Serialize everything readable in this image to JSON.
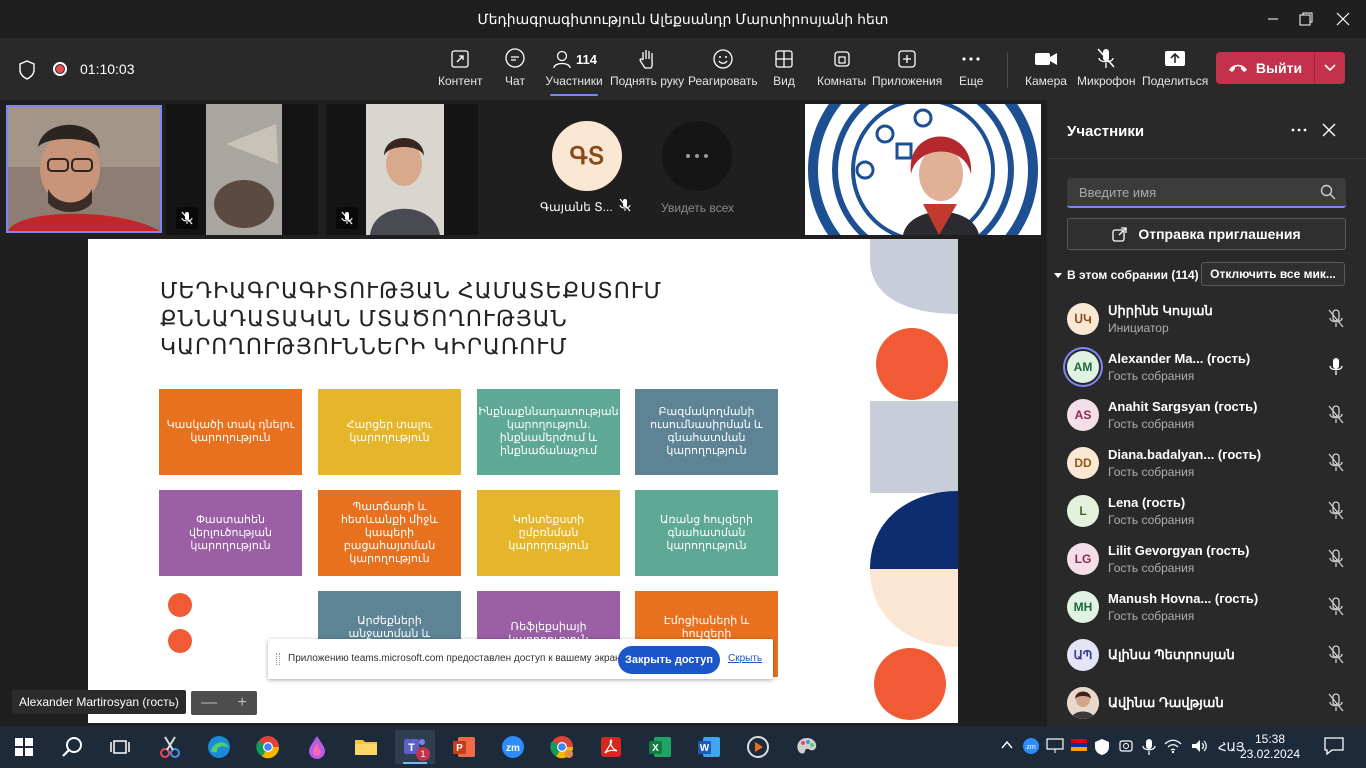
{
  "window": {
    "title": "Մեդիագրագիտություն Ալեքսանդր Մարտիրոսյանի հետ"
  },
  "toolbar": {
    "timer": "01:10:03",
    "content": "Контент",
    "chat": "Чат",
    "participants": "Участники",
    "participants_count": "114",
    "raise_hand": "Поднять руку",
    "react": "Реагировать",
    "view": "Вид",
    "rooms": "Комнаты",
    "apps": "Приложения",
    "more": "Еще",
    "camera": "Камера",
    "mic": "Микрофон",
    "share": "Поделиться",
    "leave": "Выйти"
  },
  "stage": {
    "gs_initials": "ԳՏ",
    "gs_name": "Գայանե Տ...",
    "see_all": "Увидеть всех",
    "speaker_label": "Alexander Martirosyan (гость)",
    "zoom_minus": "—",
    "zoom_plus": "+"
  },
  "slide": {
    "title_line1": "ՄԵԴԻԱԳՐԱԳԻՏՈՒԹՅԱՆ ՀԱՄԱՏԵՔՍՏՈՒՄ",
    "title_line2": "ՔՆՆԱԴԱՏԱԿԱՆ ՄՏԱԾՈՂՈՒԹՅԱՆ",
    "title_line3": "ԿԱՐՈՂՈՒԹՅՈՒՆՆԵՐԻ ԿԻՐԱՌՈՒՄ",
    "boxes": [
      "Կասկածի տակ դնելու կարողություն",
      "Հարցեր տալու կարողություն",
      "Ինքնաքննադատության կարողություն. ինքնամերժում և ինքնաճանաչում",
      "Բազմակողմանի ուսումնասիրման և գնահատման կարողություն",
      "Փաստահեն վերլուծության կարողություն",
      "Պատճառի և հետևանքի միջև կապերի բացահայտման կարողություն",
      "Կոնտեքստի ըմբռնման կարողություն",
      "Առանց հույզերի գնահատման կարողություն",
      "Արժեքների անջատման և միավորման",
      "Ռեֆլեքսիայի կարողություն",
      "Էմոցիաների և հույզերի բացահայտման"
    ],
    "colors": {
      "orange": "#e8711f",
      "yellow": "#e5b62b",
      "teal": "#5ea895",
      "slate": "#5d8395",
      "purple": "#9a5fa5",
      "navy": "#0e2d6f",
      "coral": "#f05a35"
    }
  },
  "share_banner": {
    "text": "Приложению teams.microsoft.com предоставлен доступ к вашему экрану.",
    "stop": "Закрыть доступ",
    "hide": "Скрыть"
  },
  "panel": {
    "title": "Участники",
    "search_placeholder": "Введите имя",
    "invite": "Отправка приглашения",
    "section": "В этом собрании (114)",
    "mute_all": "Отключить все мик...",
    "participants": [
      {
        "initials": "ՍԿ",
        "name": "Սիրինե Կոսյան",
        "role": "Инициатор",
        "bg": "#fbe8d4",
        "fg": "#8a4b1c"
      },
      {
        "initials": "AM",
        "name": "Alexander Ma...  (гость)",
        "role": "Гость собрания",
        "bg": "#dff2e4",
        "fg": "#1e6b35"
      },
      {
        "initials": "AS",
        "name": "Anahit Sargsyan (гость)",
        "role": "Гость собрания",
        "bg": "#f4dfe8",
        "fg": "#8a2a4f"
      },
      {
        "initials": "DD",
        "name": "Diana.badalyan... (гость)",
        "role": "Гость собрания",
        "bg": "#fbe8d4",
        "fg": "#8a5a1c"
      },
      {
        "initials": "L",
        "name": "Lena (гость)",
        "role": "Гость собрания",
        "bg": "#e3f0dc",
        "fg": "#3f6b24"
      },
      {
        "initials": "LG",
        "name": "Lilit Gevorgyan (гость)",
        "role": "Гость собрания",
        "bg": "#f4dfe8",
        "fg": "#8a2a4f"
      },
      {
        "initials": "MH",
        "name": "Manush Hovna... (гость)",
        "role": "Гость собрания",
        "bg": "#dff2e4",
        "fg": "#1e6b35"
      },
      {
        "initials": "ԱՊ",
        "name": "Ալինա Պետրոսյան",
        "role": "",
        "bg": "#e4e4f7",
        "fg": "#3b3b8a"
      },
      {
        "initials": "",
        "name": "Ավինա Դավթյան",
        "role": "",
        "bg": "#d6b8a8",
        "fg": "#5a3a2a"
      }
    ]
  },
  "taskbar": {
    "lang": "ՀԱՅ",
    "time": "15:38",
    "date": "23.02.2024",
    "teams_badge": "1"
  }
}
